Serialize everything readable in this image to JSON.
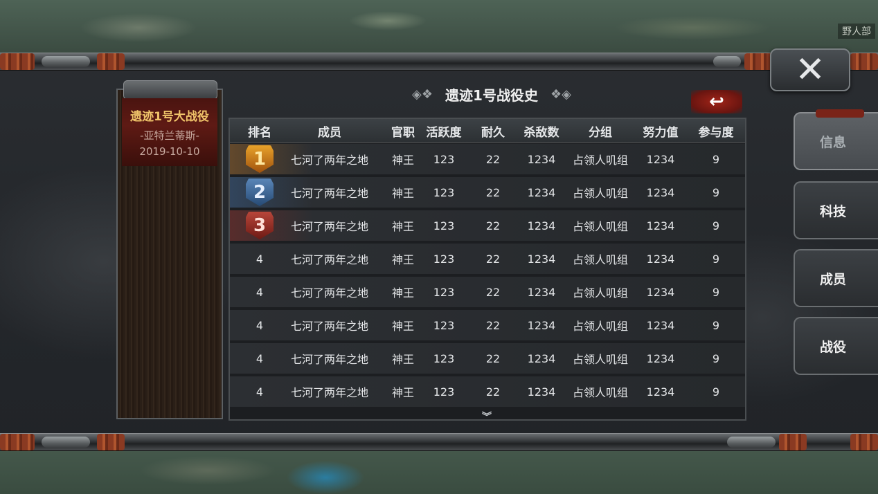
{
  "map": {
    "label": "野人部"
  },
  "close_icon": "✕",
  "battle": {
    "name": "遗迹1号大战役",
    "faction": "-亚特兰蒂斯-",
    "date": "2019-10-10"
  },
  "panel": {
    "title": "遗迹1号战役史",
    "back_icon": "↩"
  },
  "table": {
    "headers": [
      "排名",
      "成员",
      "官职",
      "活跃度",
      "耐久",
      "杀敌数",
      "分组",
      "努力值",
      "参与度"
    ],
    "rows": [
      {
        "rank": "1",
        "member": "七河了两年之地",
        "title": "神王",
        "activity": "123",
        "durability": "22",
        "kills": "1234",
        "group": "占领人叽组",
        "effort": "1234",
        "participation": "9"
      },
      {
        "rank": "2",
        "member": "七河了两年之地",
        "title": "神王",
        "activity": "123",
        "durability": "22",
        "kills": "1234",
        "group": "占领人叽组",
        "effort": "1234",
        "participation": "9"
      },
      {
        "rank": "3",
        "member": "七河了两年之地",
        "title": "神王",
        "activity": "123",
        "durability": "22",
        "kills": "1234",
        "group": "占领人叽组",
        "effort": "1234",
        "participation": "9"
      },
      {
        "rank": "4",
        "member": "七河了两年之地",
        "title": "神王",
        "activity": "123",
        "durability": "22",
        "kills": "1234",
        "group": "占领人叽组",
        "effort": "1234",
        "participation": "9"
      },
      {
        "rank": "4",
        "member": "七河了两年之地",
        "title": "神王",
        "activity": "123",
        "durability": "22",
        "kills": "1234",
        "group": "占领人叽组",
        "effort": "1234",
        "participation": "9"
      },
      {
        "rank": "4",
        "member": "七河了两年之地",
        "title": "神王",
        "activity": "123",
        "durability": "22",
        "kills": "1234",
        "group": "占领人叽组",
        "effort": "1234",
        "participation": "9"
      },
      {
        "rank": "4",
        "member": "七河了两年之地",
        "title": "神王",
        "activity": "123",
        "durability": "22",
        "kills": "1234",
        "group": "占领人叽组",
        "effort": "1234",
        "participation": "9"
      },
      {
        "rank": "4",
        "member": "七河了两年之地",
        "title": "神王",
        "activity": "123",
        "durability": "22",
        "kills": "1234",
        "group": "占领人叽组",
        "effort": "1234",
        "participation": "9"
      }
    ],
    "more_icon": "︾"
  },
  "tabs": [
    {
      "label": "信息",
      "active": true
    },
    {
      "label": "科技",
      "active": false
    },
    {
      "label": "成员",
      "active": false
    },
    {
      "label": "战役",
      "active": false
    }
  ]
}
